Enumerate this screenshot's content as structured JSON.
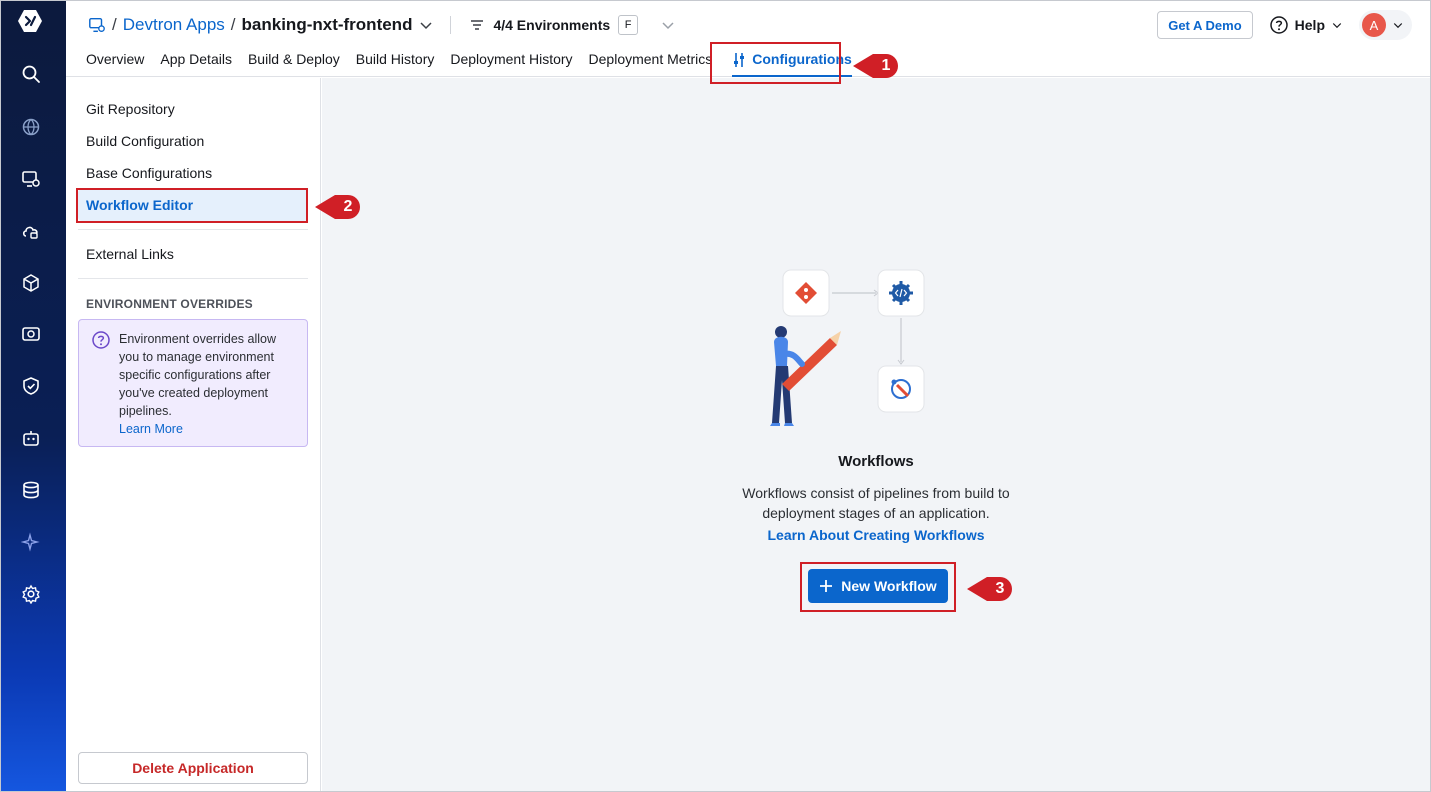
{
  "header": {
    "breadcrumb_sep": "/",
    "breadcrumb_root": "Devtron Apps",
    "app_name": "banking-nxt-frontend",
    "env_filter": "4/4 Environments",
    "env_badge": "F",
    "demo_button": "Get A Demo",
    "help": "Help",
    "avatar_initial": "A"
  },
  "tabs": [
    {
      "label": "Overview"
    },
    {
      "label": "App Details"
    },
    {
      "label": "Build & Deploy"
    },
    {
      "label": "Build History"
    },
    {
      "label": "Deployment History"
    },
    {
      "label": "Deployment Metrics"
    },
    {
      "label": "Configurations",
      "active": true
    }
  ],
  "sidebar": {
    "items": [
      {
        "label": "Git Repository"
      },
      {
        "label": "Build Configuration"
      },
      {
        "label": "Base Configurations"
      },
      {
        "label": "Workflow Editor",
        "active": true
      },
      {
        "label": "External Links"
      }
    ],
    "overrides_heading": "ENVIRONMENT OVERRIDES",
    "info_text": "Environment overrides allow you to manage environment specific configurations after you've created deployment pipelines.",
    "info_link": "Learn More",
    "delete_button": "Delete Application"
  },
  "main": {
    "title": "Workflows",
    "desc_line1": "Workflows consist of pipelines from build to",
    "desc_line2": "deployment stages of an application.",
    "learn_link": "Learn About Creating Workflows",
    "new_button": "New Workflow"
  },
  "annotations": [
    "1",
    "2",
    "3"
  ],
  "colors": {
    "accent": "#0b66cc",
    "annotation": "#d01f26",
    "danger": "#c62828"
  }
}
